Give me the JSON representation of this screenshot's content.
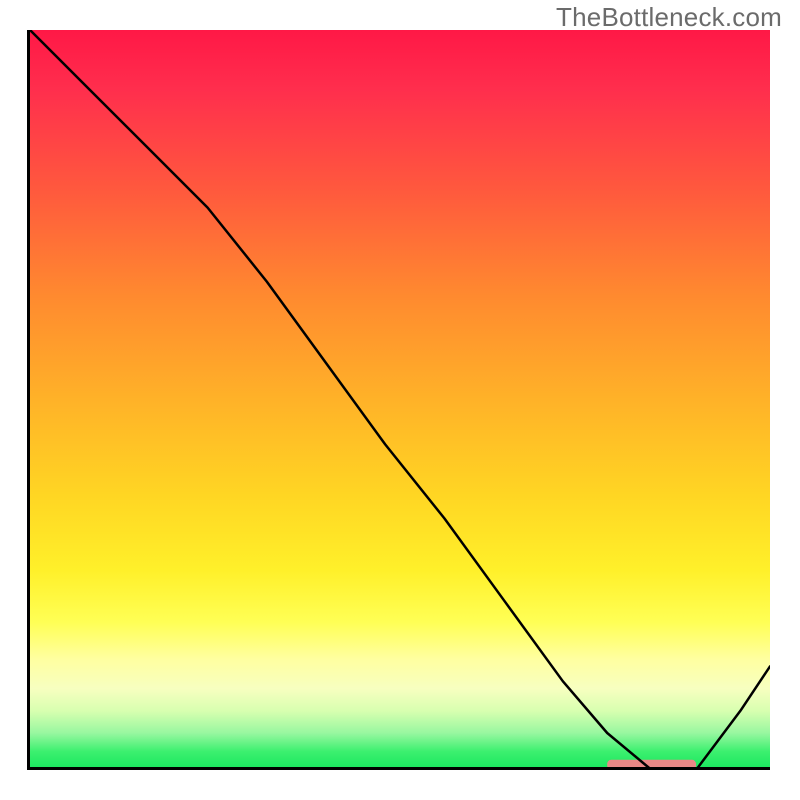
{
  "watermark": "TheBottleneck.com",
  "chart_data": {
    "type": "line",
    "title": "",
    "xlabel": "",
    "ylabel": "",
    "xlim": [
      0,
      100
    ],
    "ylim": [
      0,
      100
    ],
    "grid": false,
    "series": [
      {
        "name": "curve",
        "x": [
          0,
          8,
          16,
          24,
          32,
          40,
          48,
          56,
          64,
          72,
          78,
          84,
          90,
          96,
          100
        ],
        "values": [
          100,
          92,
          84,
          76,
          66,
          55,
          44,
          34,
          23,
          12,
          5,
          0,
          0,
          8,
          14
        ]
      }
    ],
    "highlight_band": {
      "x_start": 78,
      "x_end": 90,
      "y": 0.7,
      "color": "#e98886"
    },
    "gradient_stops": [
      {
        "pos": 0,
        "color": "#ff1846"
      },
      {
        "pos": 22,
        "color": "#ff5a3d"
      },
      {
        "pos": 50,
        "color": "#ffb228"
      },
      {
        "pos": 73,
        "color": "#fff02a"
      },
      {
        "pos": 85,
        "color": "#ffffa0"
      },
      {
        "pos": 95,
        "color": "#98f7a0"
      },
      {
        "pos": 100,
        "color": "#17e65e"
      }
    ]
  }
}
